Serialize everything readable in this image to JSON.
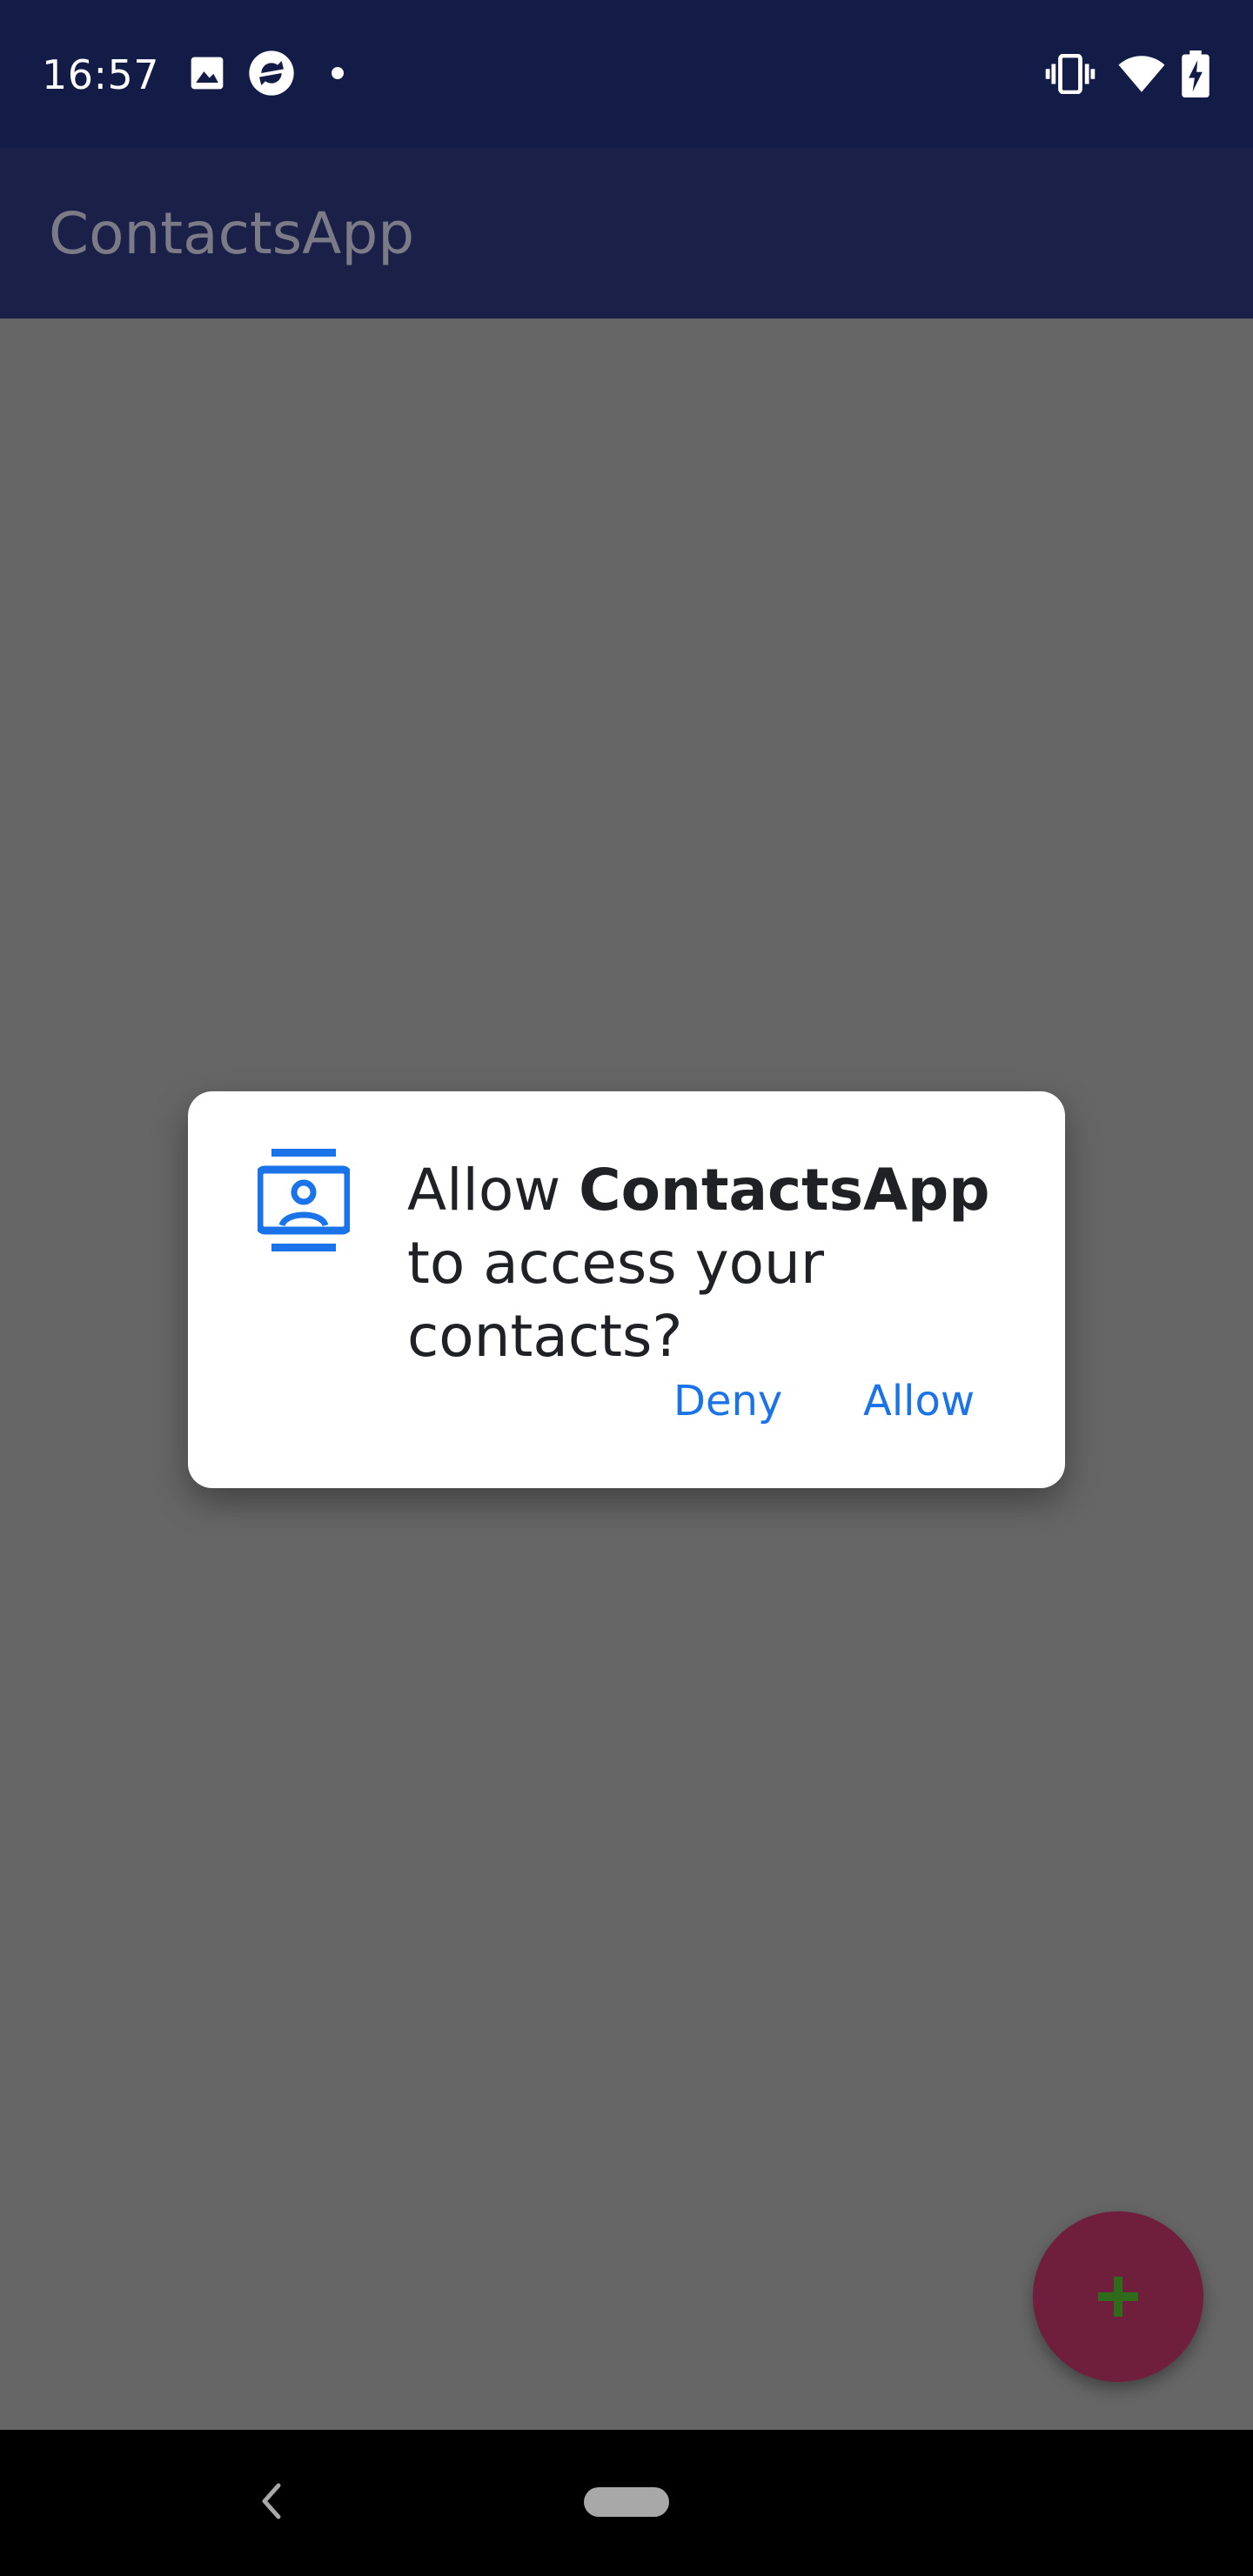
{
  "status_bar": {
    "time": "16:57",
    "left_icons": [
      "image-icon",
      "sync-icon",
      "dot-icon"
    ],
    "right_icons": [
      "vibrate-icon",
      "wifi-icon",
      "battery-charging-icon"
    ]
  },
  "app_bar": {
    "title": "ContactsApp"
  },
  "dialog": {
    "icon": "contacts-icon",
    "message_prefix": "Allow ",
    "app_name": "ContactsApp",
    "message_suffix": " to access your contacts?",
    "deny_label": "Deny",
    "allow_label": "Allow"
  },
  "fab": {
    "icon": "plus-icon"
  },
  "nav_bar": {
    "back_icon": "back-icon",
    "home_icon": "home-pill-icon"
  },
  "colors": {
    "status_bar": "#131b47",
    "app_bar": "#1b2049",
    "scrim_background": "#666666",
    "dialog_accent": "#1a73e8",
    "fab": "#6f1f3c",
    "fab_icon": "#2e6b1a"
  }
}
